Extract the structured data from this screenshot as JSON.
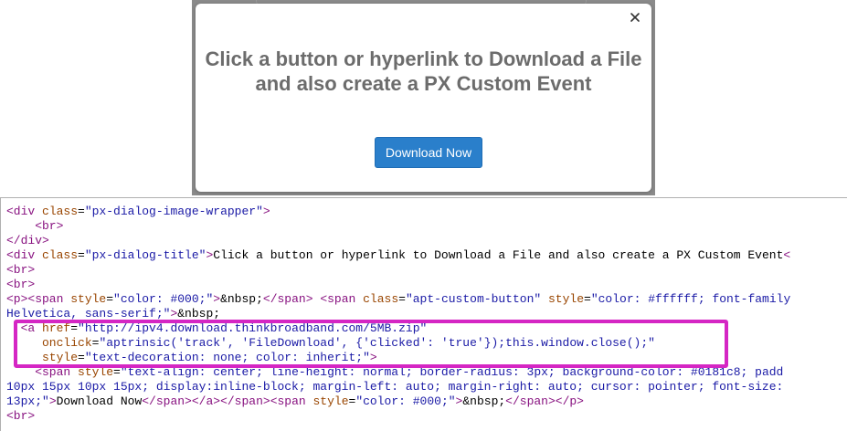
{
  "modal": {
    "title": "Click a button or hyperlink to Download a File and also create a PX Custom Event",
    "button_label": "Download Now",
    "close_icon": "close-icon",
    "button_color": "#2a7fcb",
    "title_color": "#6c6c6c"
  },
  "highlight_color": "#d526c4",
  "code_lines": [
    [
      {
        "c": "tg",
        "t": "<div "
      },
      {
        "c": "at",
        "t": "class"
      },
      {
        "c": "tx",
        "t": "="
      },
      {
        "c": "vl",
        "t": "\"px-dialog-image-wrapper\""
      },
      {
        "c": "tg",
        "t": ">"
      }
    ],
    [
      {
        "c": "tg",
        "t": "    <br>"
      }
    ],
    [
      {
        "c": "tg",
        "t": "</div>"
      }
    ],
    [
      {
        "c": "tg",
        "t": "<div "
      },
      {
        "c": "at",
        "t": "class"
      },
      {
        "c": "tx",
        "t": "="
      },
      {
        "c": "vl",
        "t": "\"px-dialog-title\""
      },
      {
        "c": "tg",
        "t": ">"
      },
      {
        "c": "tx",
        "t": "Click a button or hyperlink to Download a File and also create a PX Custom Event"
      },
      {
        "c": "tg",
        "t": "<"
      }
    ],
    [
      {
        "c": "tg",
        "t": "<br>"
      }
    ],
    [
      {
        "c": "tg",
        "t": "<br>"
      }
    ],
    [
      {
        "c": "tg",
        "t": "<p><span "
      },
      {
        "c": "at",
        "t": "style"
      },
      {
        "c": "tx",
        "t": "="
      },
      {
        "c": "vl",
        "t": "\"color: #000;\""
      },
      {
        "c": "tg",
        "t": ">"
      },
      {
        "c": "tx",
        "t": "&nbsp;"
      },
      {
        "c": "tg",
        "t": "</span>"
      },
      {
        "c": "tx",
        "t": " "
      },
      {
        "c": "tg",
        "t": "<span "
      },
      {
        "c": "at",
        "t": "class"
      },
      {
        "c": "tx",
        "t": "="
      },
      {
        "c": "vl",
        "t": "\"apt-custom-button\""
      },
      {
        "c": "tx",
        "t": " "
      },
      {
        "c": "at",
        "t": "style"
      },
      {
        "c": "tx",
        "t": "="
      },
      {
        "c": "vl",
        "t": "\"color: #ffffff; font-family"
      }
    ],
    [
      {
        "c": "vl",
        "t": "Helvetica, sans-serif;\""
      },
      {
        "c": "tg",
        "t": ">"
      },
      {
        "c": "tx",
        "t": "&nbsp;"
      }
    ],
    [
      {
        "c": "tg",
        "t": "  <a "
      },
      {
        "c": "at",
        "t": "href"
      },
      {
        "c": "tx",
        "t": "="
      },
      {
        "c": "vl",
        "t": "\"http://ipv4.download.thinkbroadband.com/5MB.zip\""
      }
    ],
    [
      {
        "c": "at",
        "t": "     onclick"
      },
      {
        "c": "tx",
        "t": "="
      },
      {
        "c": "vl",
        "t": "\"aptrinsic('track', 'FileDownload', {'clicked': 'true'});this.window.close();\""
      }
    ],
    [
      {
        "c": "at",
        "t": "     style"
      },
      {
        "c": "tx",
        "t": "="
      },
      {
        "c": "vl",
        "t": "\"text-decoration: none; color: inherit;\""
      },
      {
        "c": "tg",
        "t": ">"
      }
    ],
    [
      {
        "c": "tg",
        "t": "    <span "
      },
      {
        "c": "at",
        "t": "style"
      },
      {
        "c": "tx",
        "t": "="
      },
      {
        "c": "vl",
        "t": "\"text-align: center; line-height: normal; border-radius: 3px; background-color: #0181c8; padd"
      }
    ],
    [
      {
        "c": "vl",
        "t": "10px 15px 10px 15px; display:inline-block; margin-left: auto; margin-right: auto; cursor: pointer; font-size:"
      }
    ],
    [
      {
        "c": "vl",
        "t": "13px;\""
      },
      {
        "c": "tg",
        "t": ">"
      },
      {
        "c": "tx",
        "t": "Download Now"
      },
      {
        "c": "tg",
        "t": "</span></a>"
      },
      {
        "c": "tg",
        "t": "</span>"
      },
      {
        "c": "tg",
        "t": "<span "
      },
      {
        "c": "at",
        "t": "style"
      },
      {
        "c": "tx",
        "t": "="
      },
      {
        "c": "vl",
        "t": "\"color: #000;\""
      },
      {
        "c": "tg",
        "t": ">"
      },
      {
        "c": "tx",
        "t": "&nbsp;"
      },
      {
        "c": "tg",
        "t": "</span></p>"
      }
    ],
    [
      {
        "c": "tg",
        "t": "<br>"
      }
    ]
  ]
}
